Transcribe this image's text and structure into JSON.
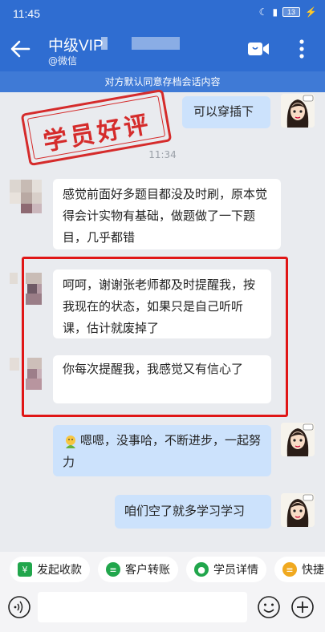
{
  "status_bar": {
    "time": "11:45",
    "battery": "13"
  },
  "header": {
    "title": "中级VIP",
    "subtitle": "@微信"
  },
  "notice": "对方默认同意存档会话内容",
  "stamp_text": "学员好评",
  "timestamp": "11:34",
  "messages": [
    {
      "side": "right",
      "text": "可以穿插下"
    },
    {
      "side": "left",
      "text": "感觉前面好多题目都没及时刷，原本觉得会计实物有基础，做题做了一下题目，几乎都错"
    },
    {
      "side": "left",
      "text": "呵呵，谢谢张老师都及时提醒我，按我现在的状态，如果只是自己听听课，估计就废掉了"
    },
    {
      "side": "left",
      "text": "你每次提醒我，我感觉又有信心了"
    },
    {
      "side": "right",
      "text": "嗯嗯，没事哈，不断进步，一起努力"
    },
    {
      "side": "right",
      "text": "咱们空了就多学习学习"
    }
  ],
  "quick_actions": [
    {
      "label": "发起收款",
      "color": "#21a64c"
    },
    {
      "label": "客户转账",
      "color": "#21a64c"
    },
    {
      "label": "学员详情",
      "color": "#21a64c"
    },
    {
      "label": "快捷",
      "color": "#f0a920"
    }
  ],
  "icons": [
    "back-arrow-icon",
    "video-call-icon",
    "more-vertical-icon",
    "voice-icon",
    "emoji-icon",
    "plus-icon",
    "thumbs-up-emoji-icon"
  ],
  "colors": {
    "header_bg": "#2f6dd1",
    "notice_bg": "#3f7ad6",
    "right_bubble": "#cce2fc",
    "left_bubble": "#ffffff",
    "highlight": "#e01616",
    "stamp": "#d52b2b"
  }
}
